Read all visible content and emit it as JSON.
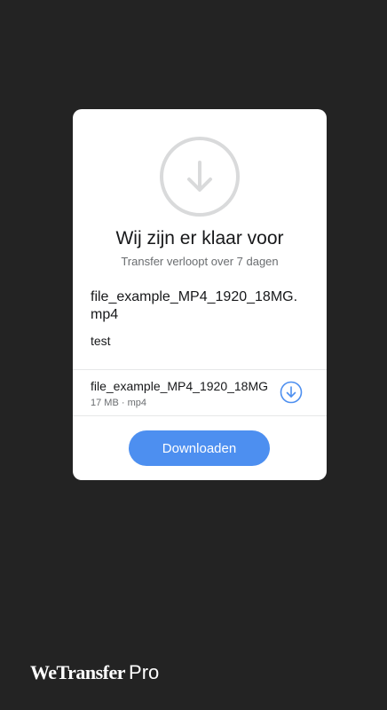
{
  "card": {
    "title": "Wij zijn er klaar voor",
    "subtitle": "Transfer verloopt over 7 dagen",
    "transfer_name": "file_example_MP4_1920_18MG.mp4",
    "message": "test",
    "hero_icon": "download-arrow-icon",
    "files": [
      {
        "name": "file_example_MP4_1920_18MG",
        "size": "17 MB",
        "type": "mp4",
        "meta": "17 MB · mp4",
        "icon": "download-circle-icon"
      }
    ],
    "download_label": "Downloaden"
  },
  "brand": {
    "name": "WeTransfer",
    "tier": "Pro"
  },
  "colors": {
    "background": "#232323",
    "card": "#ffffff",
    "accent": "#4d8ff0",
    "hero_circle": "#d9dadb",
    "text_primary": "#17181a",
    "text_secondary": "#6a6d70"
  }
}
